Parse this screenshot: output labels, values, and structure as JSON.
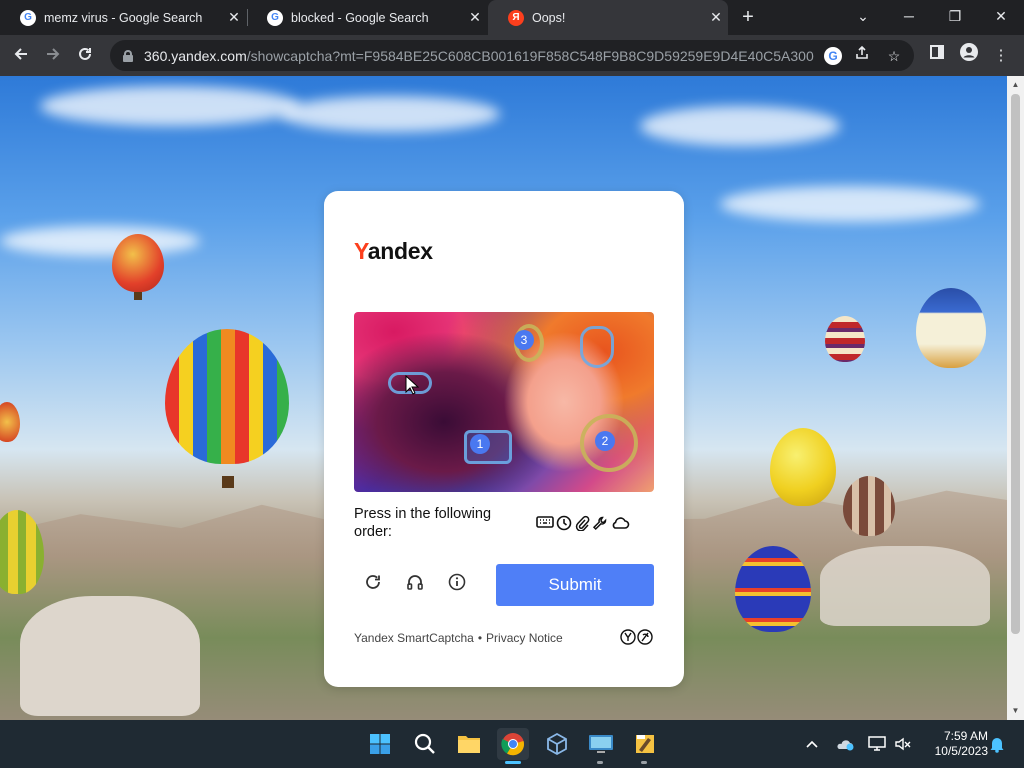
{
  "browser": {
    "tabs": [
      {
        "title": "memz virus - Google Search",
        "favicon": "google-icon",
        "active": false
      },
      {
        "title": "blocked - Google Search",
        "favicon": "google-icon",
        "active": false
      },
      {
        "title": "Oops!",
        "favicon": "yandex-icon",
        "active": true
      }
    ],
    "address": {
      "host": "360.yandex.com",
      "path": "/showcaptcha?mt=F9584BE25C608CB001619F858C548F9B8C9D59259E9D4E40C5A3000CB..."
    }
  },
  "captcha": {
    "logo_first": "Y",
    "logo_rest": "andex",
    "markers": [
      "1",
      "2",
      "3"
    ],
    "prompt": "Press in the following order:",
    "order_icons": [
      "keyboard-icon",
      "clock-icon",
      "paperclip-icon",
      "wrench-icon",
      "cloud-icon"
    ],
    "submit_label": "Submit",
    "footer_brand": "Yandex SmartCaptcha",
    "footer_sep": "•",
    "footer_privacy": "Privacy Notice",
    "accent_color": "#4f7ff7"
  },
  "taskbar": {
    "time": "7:59 AM",
    "date": "10/5/2023"
  }
}
